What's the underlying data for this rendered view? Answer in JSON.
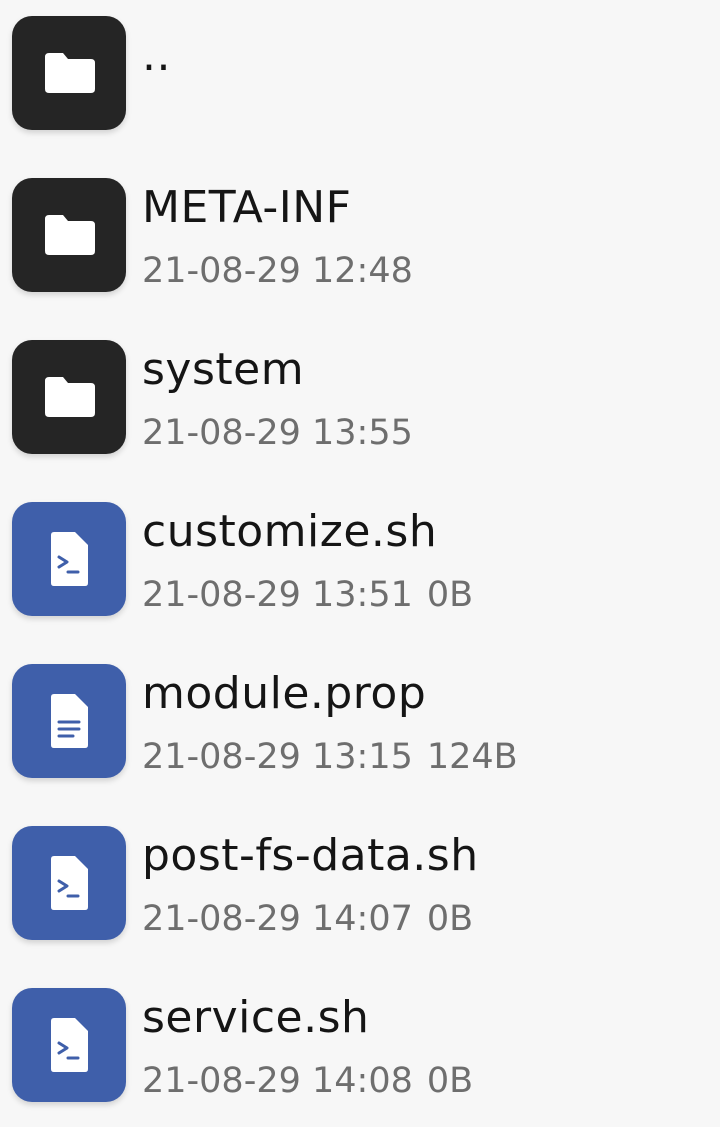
{
  "entries": [
    {
      "name": "..",
      "date": "",
      "size": "",
      "icon": "folder-icon"
    },
    {
      "name": "META-INF",
      "date": "21-08-29 12:48",
      "size": "",
      "icon": "folder-icon"
    },
    {
      "name": "system",
      "date": "21-08-29 13:55",
      "size": "",
      "icon": "folder-icon"
    },
    {
      "name": "customize.sh",
      "date": "21-08-29 13:51",
      "size": "0B",
      "icon": "script-file-icon"
    },
    {
      "name": "module.prop",
      "date": "21-08-29 13:15",
      "size": "124B",
      "icon": "text-file-icon"
    },
    {
      "name": "post-fs-data.sh",
      "date": "21-08-29 14:07",
      "size": "0B",
      "icon": "script-file-icon"
    },
    {
      "name": "service.sh",
      "date": "21-08-29 14:08",
      "size": "0B",
      "icon": "script-file-icon"
    }
  ],
  "colors": {
    "folder_tile": "#252525",
    "file_tile": "#3f5faa",
    "background": "#f7f7f7"
  }
}
